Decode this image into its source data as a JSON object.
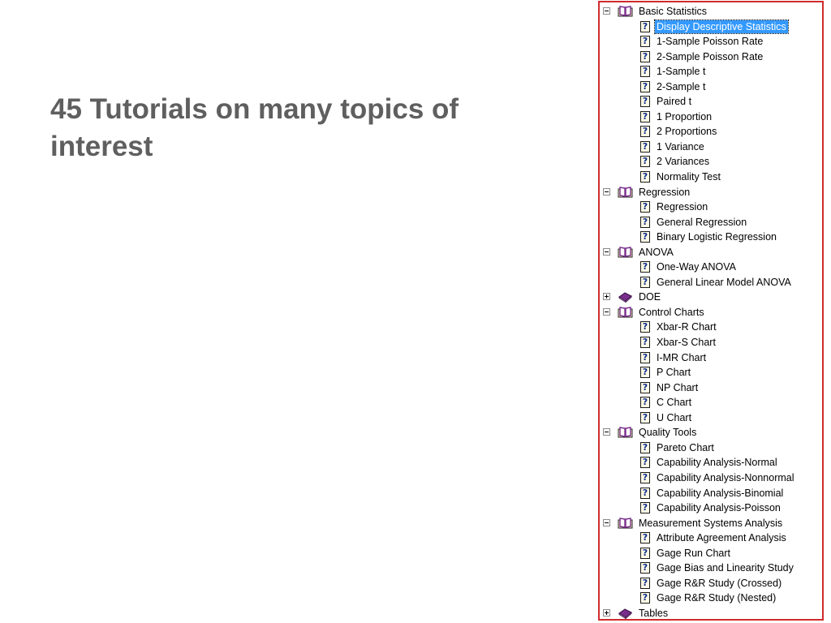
{
  "slide": {
    "title": "45 Tutorials on many topics of interest"
  },
  "tree": {
    "groups": [
      {
        "label": "Basic Statistics",
        "expanded": true,
        "icon": "open-book-icon",
        "items": [
          {
            "label": "Display Descriptive Statistics",
            "selected": true
          },
          {
            "label": "1-Sample Poisson Rate"
          },
          {
            "label": "2-Sample Poisson Rate"
          },
          {
            "label": "1-Sample t"
          },
          {
            "label": "2-Sample t"
          },
          {
            "label": "Paired t"
          },
          {
            "label": "1 Proportion"
          },
          {
            "label": "2 Proportions"
          },
          {
            "label": "1 Variance"
          },
          {
            "label": "2 Variances"
          },
          {
            "label": "Normality Test"
          }
        ]
      },
      {
        "label": "Regression",
        "expanded": true,
        "icon": "open-book-icon",
        "items": [
          {
            "label": "Regression"
          },
          {
            "label": "General Regression"
          },
          {
            "label": "Binary Logistic Regression"
          }
        ]
      },
      {
        "label": "ANOVA",
        "expanded": true,
        "icon": "open-book-icon",
        "items": [
          {
            "label": "One-Way ANOVA"
          },
          {
            "label": "General Linear Model ANOVA"
          }
        ]
      },
      {
        "label": "DOE",
        "expanded": false,
        "icon": "closed-book-icon",
        "items": []
      },
      {
        "label": "Control Charts",
        "expanded": true,
        "icon": "open-book-icon",
        "items": [
          {
            "label": "Xbar-R Chart"
          },
          {
            "label": "Xbar-S Chart"
          },
          {
            "label": "I-MR Chart"
          },
          {
            "label": "P Chart"
          },
          {
            "label": "NP Chart"
          },
          {
            "label": "C Chart"
          },
          {
            "label": "U Chart"
          }
        ]
      },
      {
        "label": "Quality Tools",
        "expanded": true,
        "icon": "open-book-icon",
        "items": [
          {
            "label": "Pareto Chart"
          },
          {
            "label": "Capability Analysis-Normal"
          },
          {
            "label": "Capability Analysis-Nonnormal"
          },
          {
            "label": "Capability Analysis-Binomial"
          },
          {
            "label": "Capability Analysis-Poisson"
          }
        ]
      },
      {
        "label": "Measurement Systems Analysis",
        "expanded": true,
        "icon": "open-book-icon",
        "items": [
          {
            "label": "Attribute Agreement Analysis"
          },
          {
            "label": "Gage Run Chart"
          },
          {
            "label": "Gage Bias and Linearity Study"
          },
          {
            "label": "Gage R&R Study (Crossed)"
          },
          {
            "label": "Gage R&R Study (Nested)"
          }
        ]
      },
      {
        "label": "Tables",
        "expanded": false,
        "icon": "closed-book-icon",
        "items": []
      }
    ],
    "help_glyph": "?",
    "help_icon": "help-page-icon",
    "colors": {
      "selection": "#3399ff",
      "panel_border": "#d02b2b",
      "title_text": "#5f5f5f",
      "book_open": "#7a2e8c",
      "book_closed": "#7a2e8c"
    }
  }
}
